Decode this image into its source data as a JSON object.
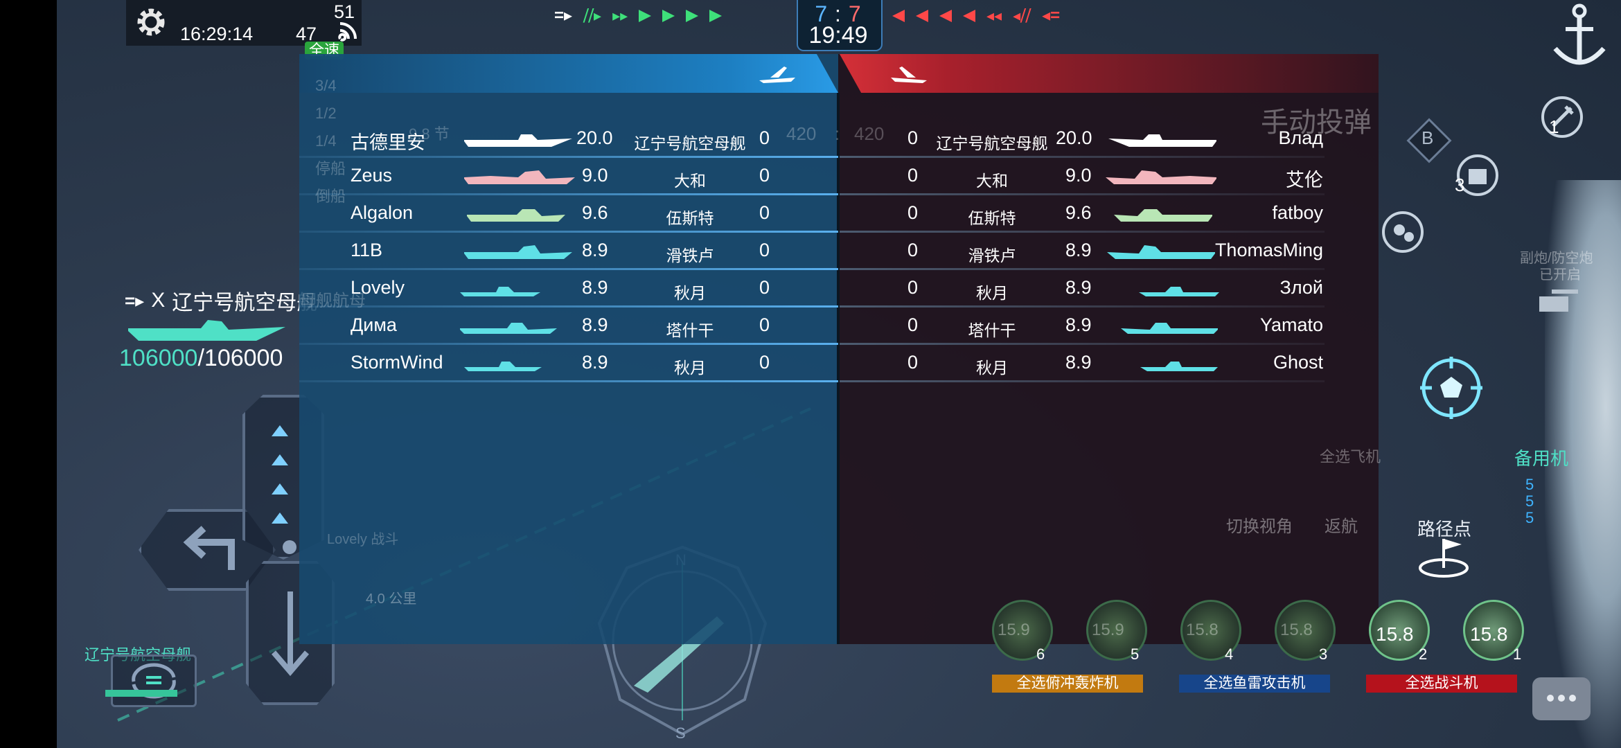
{
  "hud": {
    "time": "16:29:14",
    "fps": "47",
    "ping": "51",
    "speed_mode": "全速",
    "speed_levels": [
      "3/4",
      "1/2",
      "1/4",
      "停船",
      "倒船"
    ],
    "speed_knots": "9.8  节",
    "score_blue": "7",
    "score_sep": ":",
    "score_red": "7",
    "match_timer": "19:49",
    "team_hp_left": "420",
    "team_hp_sep": ":",
    "team_hp_right": "420"
  },
  "player": {
    "target_prefix": "X",
    "ship_name": "辽宁号航空母舰",
    "hp_current": "106000",
    "hp_max": "/106000",
    "ghost_label": "母舰航母",
    "compass_range": "4.0  公里",
    "bottom_ship_label": "辽宁号航空母舰",
    "lovely_ghost": "Lovely 战斗"
  },
  "compass": {
    "north": "N",
    "south": "S"
  },
  "scoreboard": {
    "left_team": [
      {
        "player": "古德里安",
        "score": "20.0",
        "ship": "辽宁号航空母舰",
        "kills": "0",
        "color": "#ffffff"
      },
      {
        "player": "Zeus",
        "score": "9.0",
        "ship": "大和",
        "kills": "0",
        "color": "#f2b6bd"
      },
      {
        "player": "Algalon",
        "score": "9.6",
        "ship": "伍斯特",
        "kills": "0",
        "color": "#b9e6b5"
      },
      {
        "player": "11B",
        "score": "8.9",
        "ship": "滑铁卢",
        "kills": "0",
        "color": "#5fe0e6"
      },
      {
        "player": "Lovely",
        "score": "8.9",
        "ship": "秋月",
        "kills": "0",
        "color": "#5fe0e6"
      },
      {
        "player": "Дима",
        "score": "8.9",
        "ship": "塔什干",
        "kills": "0",
        "color": "#5fe0e6"
      },
      {
        "player": "StormWind",
        "score": "8.9",
        "ship": "秋月",
        "kills": "0",
        "color": "#5fe0e6"
      }
    ],
    "right_team": [
      {
        "player": "Влад",
        "score": "20.0",
        "ship": "辽宁号航空母舰",
        "kills": "0",
        "color": "#ffffff"
      },
      {
        "player": "艾伦",
        "score": "9.0",
        "ship": "大和",
        "kills": "0",
        "color": "#f2b6bd"
      },
      {
        "player": "fatboy",
        "score": "9.6",
        "ship": "伍斯特",
        "kills": "0",
        "color": "#b9e6b5"
      },
      {
        "player": "ThomasMing",
        "score": "8.9",
        "ship": "滑铁卢",
        "kills": "0",
        "color": "#5fe0e6"
      },
      {
        "player": "Злой",
        "score": "8.9",
        "ship": "秋月",
        "kills": "0",
        "color": "#5fe0e6"
      },
      {
        "player": "Yamato",
        "score": "8.9",
        "ship": "塔什干",
        "kills": "0",
        "color": "#5fe0e6"
      },
      {
        "player": "Ghost",
        "score": "8.9",
        "ship": "秋月",
        "kills": "0",
        "color": "#5fe0e6"
      }
    ]
  },
  "right_hud": {
    "manual_bomb": "手动投弹",
    "b_marker": "B",
    "ammo_count_1": "1",
    "ammo_count_3": "3",
    "secondary_guns": "副炮/防空炮",
    "secondary_state": "已开启",
    "select_all_planes": "全选飞机",
    "switch_view": "切换视角",
    "return": "返航",
    "waypoint": "路径点",
    "reserve": "备用机",
    "reserve_counts": [
      "5",
      "5",
      "5"
    ]
  },
  "aircraft_slots": [
    {
      "time": "15.9",
      "index": "6"
    },
    {
      "time": "15.9",
      "index": "5"
    },
    {
      "time": "15.8",
      "index": "4"
    },
    {
      "time": "15.8",
      "index": "3"
    },
    {
      "time": "15.8",
      "index": "2"
    },
    {
      "time": "15.8",
      "index": "1"
    }
  ],
  "select_buttons": {
    "dive_bomber": "全选俯冲轰炸机",
    "torpedo": "全选鱼雷攻击机",
    "fighter": "全选战斗机"
  },
  "colors": {
    "team_blue": "#1d7fc2",
    "team_red": "#d53038",
    "score_blue": "#5cb6ff",
    "score_red": "#ff6b6b",
    "hp_green": "#4fe0c6",
    "bomber_btn": "#c27a10",
    "torpedo_btn": "#17458a",
    "fighter_btn": "#b5121c"
  }
}
